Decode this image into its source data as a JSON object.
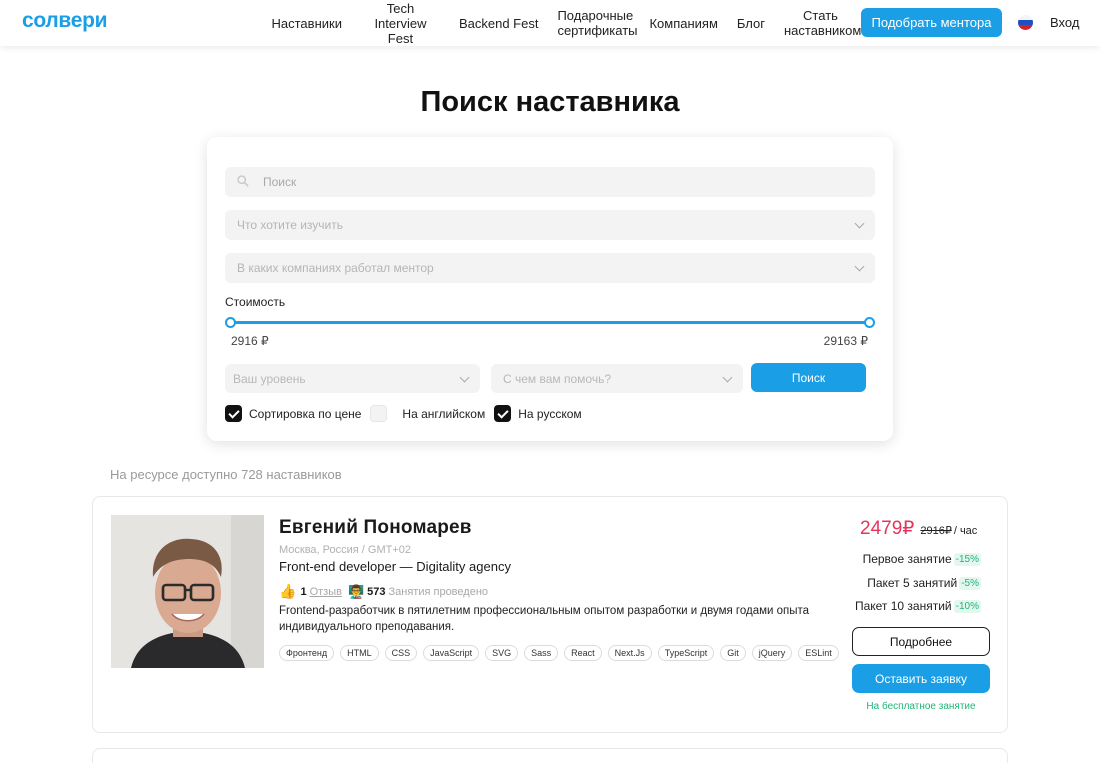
{
  "brand": {
    "logo": "солвери",
    "accent": "#1a9fe6"
  },
  "nav": [
    {
      "label": "Наставники"
    },
    {
      "label": "Tech Interview Fest"
    },
    {
      "label": "Backend Fest"
    },
    {
      "label": "Подарочные сертификаты"
    },
    {
      "label": "Компаниям"
    },
    {
      "label": "Блог"
    },
    {
      "label": "Стать наставником"
    }
  ],
  "header": {
    "cta": "Подобрать ментора",
    "login": "Вход",
    "flag_icon": "russia-flag-icon"
  },
  "page_title": "Поиск наставника",
  "search": {
    "query_placeholder": "Поиск",
    "topic_placeholder": "Что хотите изучить",
    "company_placeholder": "В каких компаниях работал ментор",
    "cost_label": "Стоимость",
    "price_min": "2916 ₽",
    "price_max": "29163 ₽",
    "level_placeholder": "Ваш уровень",
    "help_placeholder": "С чем вам помочь?",
    "submit": "Поиск",
    "checkboxes": [
      {
        "label": "Сортировка по цене",
        "checked": true
      },
      {
        "label": "На английском",
        "checked": false
      },
      {
        "label": "На русском",
        "checked": true
      }
    ]
  },
  "available_text": "На ресурсе доступно 728 наставников",
  "mentor": {
    "name": "Евгений Пономарев",
    "location": "Москва, Россия / GMT+02",
    "role": "Front-end developer — Digitality agency",
    "likes": "1",
    "reviews_label": "Отзыв",
    "sessions": "573",
    "sessions_label": "Занятия проведено",
    "description": "Frontend-разработчик в пятилетним профессиональным опытом разработки и двумя годами опыта индивидуального преподавания.",
    "tags": [
      "Фронтенд",
      "HTML",
      "CSS",
      "JavaScript",
      "SVG",
      "Sass",
      "React",
      "Next.Js",
      "TypeScript",
      "Git",
      "jQuery",
      "ESLint"
    ],
    "price_now": "2479₽",
    "price_old": "2916₽",
    "price_unit": "/ час",
    "discounts": [
      {
        "label": "Первое занятие",
        "pct": "-15%"
      },
      {
        "label": "Пакет 5 занятий",
        "pct": "-5%"
      },
      {
        "label": "Пакет 10 занятий",
        "pct": "-10%"
      }
    ],
    "more_btn": "Подробнее",
    "request_btn": "Оставить заявку",
    "free_text": "На бесплатное занятие"
  }
}
